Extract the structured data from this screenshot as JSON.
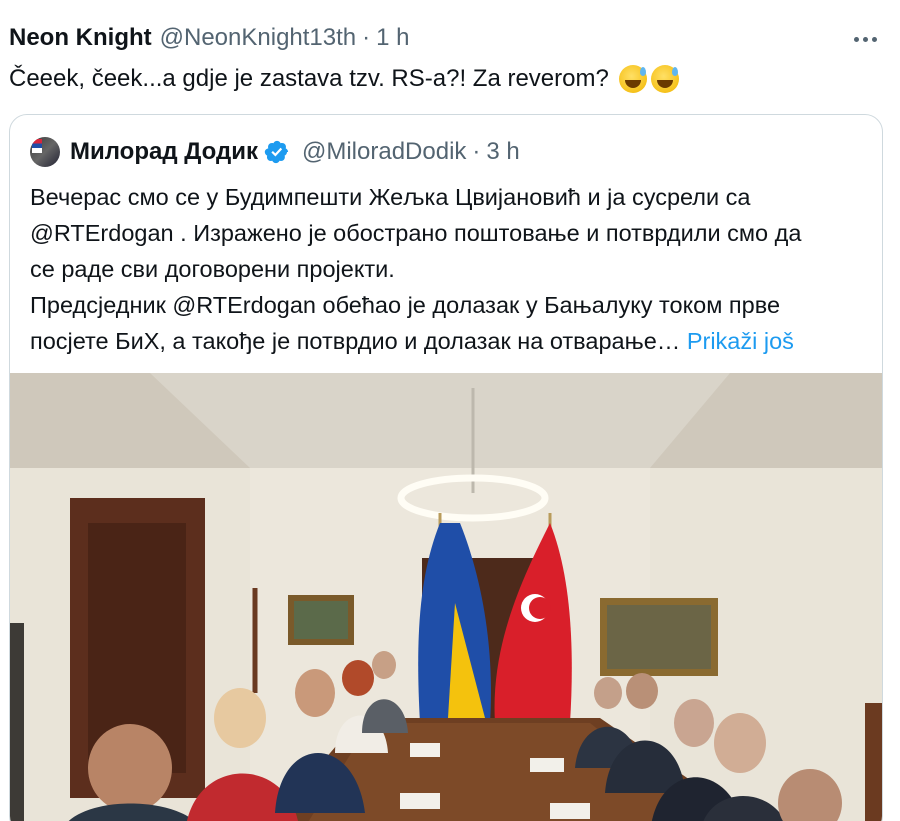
{
  "tweet": {
    "display_name": "Neon Knight",
    "handle": "@NeonKnight13th",
    "separator": "·",
    "time": "1 h",
    "text": "Čeeek, čeek...a gdje je zastava tzv. RS-a?! Za reverom?",
    "emojis": [
      "grinning-face-with-sweat",
      "grinning-face-with-sweat"
    ]
  },
  "quote": {
    "display_name": "Милорад Додик",
    "handle": "@MiloradDodik",
    "separator": "·",
    "time": "3 h",
    "lines": [
      "Вечерас смо се у Будимпешти Жељка Цвијановић и ја сусрели са",
      "@RTErdogan . Изражено је обострано поштовање и потврдили смо да",
      "се раде сви договорени пројекти.",
      "Предсједник @RTErdogan обећао је долазак у Бањалуку током прве",
      "посјете БиХ, а такође је потврдио и долазак на отварање…"
    ],
    "show_more": "Prikaži još"
  },
  "colors": {
    "text_primary": "#0f1419",
    "text_secondary": "#536471",
    "link": "#1d9bf0",
    "border": "#cfd9de",
    "verified": "#1d9bf0"
  },
  "icons": [
    "more-icon",
    "verified-badge-icon"
  ]
}
